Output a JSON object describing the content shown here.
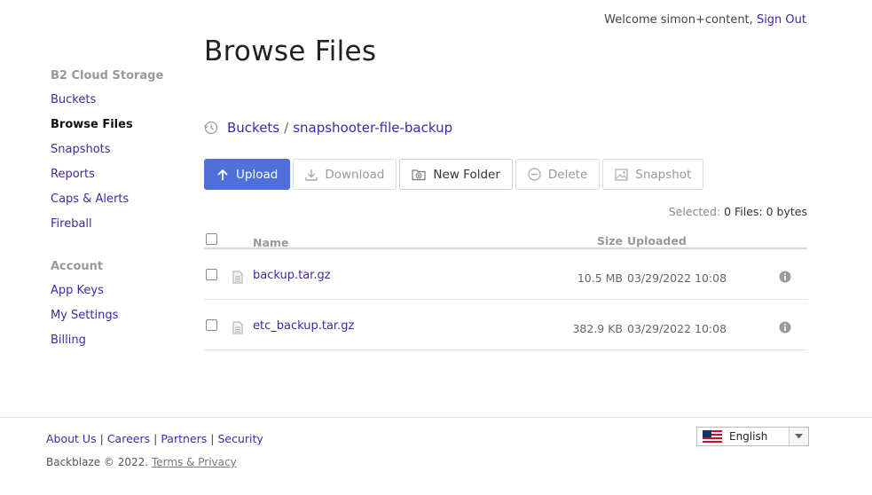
{
  "header": {
    "welcome_text": "Welcome simon+content,",
    "sign_out": "Sign Out"
  },
  "sidebar": {
    "section1": "B2 Cloud Storage",
    "items1": [
      {
        "label": "Buckets",
        "active": false
      },
      {
        "label": "Browse Files",
        "active": true
      },
      {
        "label": "Snapshots",
        "active": false
      },
      {
        "label": "Reports",
        "active": false
      },
      {
        "label": "Caps & Alerts",
        "active": false
      },
      {
        "label": "Fireball",
        "active": false
      }
    ],
    "section2": "Account",
    "items2": [
      {
        "label": "App Keys"
      },
      {
        "label": "My Settings"
      },
      {
        "label": "Billing"
      }
    ]
  },
  "main": {
    "title": "Browse Files",
    "breadcrumb": {
      "root": "Buckets",
      "separator": "/",
      "current": "snapshooter-file-backup"
    },
    "toolbar": {
      "upload": "Upload",
      "download": "Download",
      "new_folder": "New Folder",
      "delete": "Delete",
      "snapshot": "Snapshot"
    },
    "selected": {
      "label": "Selected:",
      "value": "0 Files: 0 bytes"
    },
    "table": {
      "columns": {
        "name": "Name",
        "size": "Size",
        "uploaded": "Uploaded"
      },
      "rows": [
        {
          "name": "backup.tar.gz",
          "size": "10.5 MB",
          "uploaded": "03/29/2022 10:08"
        },
        {
          "name": "etc_backup.tar.gz",
          "size": "382.9 KB",
          "uploaded": "03/29/2022 10:08"
        }
      ]
    }
  },
  "footer": {
    "links": [
      "About Us",
      "Careers",
      "Partners",
      "Security"
    ],
    "copyright": "Backblaze © 2022.",
    "terms": "Terms & Privacy",
    "language": "English"
  },
  "colors": {
    "link": "#4427a5",
    "primary_button": "#4f6fdb"
  },
  "icons": {
    "breadcrumb": "history-icon",
    "upload": "arrow-up-icon",
    "download": "download-icon",
    "new_folder": "folder-add-icon",
    "delete": "minus-circle-icon",
    "snapshot": "image-icon",
    "file": "file-icon",
    "info": "info-icon",
    "flag": "us-flag-icon"
  }
}
